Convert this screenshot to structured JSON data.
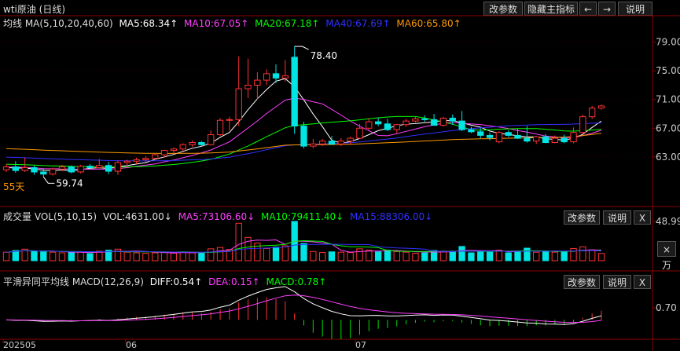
{
  "title": "wti原油 (日线)",
  "toolbar": {
    "edit_params": "改参数",
    "hide_indicator": "隐藏主指标",
    "left_arrow": "←",
    "right_arrow": "→",
    "help": "说明"
  },
  "ma_legend": {
    "label": "均线 MA(5,10,20,40,60)",
    "ma5": "MA5:68.34↑",
    "ma10": "MA10:67.05↑",
    "ma20": "MA20:67.18↑",
    "ma40": "MA40:67.69↑",
    "ma60": "MA60:65.80↑"
  },
  "vol_legend": {
    "label": "成交量 VOL(5,10,15)",
    "vol": "VOL:4631.00↓",
    "ma5": "MA5:73106.60↓",
    "ma10": "MA10:79411.40↓",
    "ma15": "MA15:88306.00↓"
  },
  "macd_legend": {
    "label": "平滑异同平均线 MACD(12,26,9)",
    "diff": "DIFF:0.54↑",
    "dea": "DEA:0.15↑",
    "macd": "MACD:0.78↑"
  },
  "panel_buttons": {
    "edit_params": "改参数",
    "help": "说明",
    "close": "X"
  },
  "vol_unit_button": "×万",
  "annotations": {
    "high": "78.40",
    "low": "59.74",
    "days": "55天"
  },
  "x_labels": [
    "202505",
    "06",
    "07"
  ],
  "colors": {
    "up": "#ff3232",
    "down": "#00e4e4",
    "ma5": "#ffffff",
    "ma10": "#ff40ff",
    "ma20": "#00ff00",
    "ma40": "#3030ff",
    "ma60": "#ff9900"
  },
  "chart_data": [
    {
      "type": "candlestick",
      "title": "wti原油 (日线)",
      "ylim": [
        57.5,
        80.5
      ],
      "yticks": [
        "79.00",
        "75.00",
        "71.00",
        "67.00",
        "63.00"
      ],
      "candles": [
        [
          61.2,
          62.0,
          60.9,
          61.6
        ],
        [
          61.6,
          62.4,
          60.8,
          61.1
        ],
        [
          61.1,
          62.9,
          60.9,
          61.5
        ],
        [
          61.5,
          61.8,
          60.5,
          60.9
        ],
        [
          60.9,
          61.4,
          60.2,
          60.6
        ],
        [
          60.6,
          61.5,
          60.4,
          61.3
        ],
        [
          61.3,
          61.9,
          61.0,
          61.6
        ],
        [
          61.6,
          61.8,
          60.7,
          60.9
        ],
        [
          60.9,
          61.9,
          60.7,
          61.7
        ],
        [
          61.7,
          62.0,
          61.3,
          61.5
        ],
        [
          61.5,
          62.7,
          61.3,
          61.8
        ],
        [
          61.8,
          62.3,
          60.6,
          61.0
        ],
        [
          61.0,
          62.5,
          60.5,
          62.2
        ],
        [
          62.2,
          62.6,
          61.5,
          62.4
        ],
        [
          62.4,
          62.9,
          62.0,
          62.6
        ],
        [
          62.6,
          63.1,
          62.3,
          62.8
        ],
        [
          62.8,
          63.4,
          62.5,
          63.3
        ],
        [
          63.3,
          64.0,
          62.9,
          63.9
        ],
        [
          63.9,
          64.3,
          63.5,
          64.1
        ],
        [
          64.1,
          64.9,
          63.8,
          64.7
        ],
        [
          64.7,
          65.3,
          64.4,
          65.0
        ],
        [
          65.0,
          65.2,
          64.4,
          64.7
        ],
        [
          64.7,
          66.7,
          64.6,
          66.1
        ],
        [
          66.1,
          68.4,
          65.9,
          68.1
        ],
        [
          68.1,
          68.6,
          66.7,
          68.2
        ],
        [
          68.2,
          77.0,
          67.3,
          72.5
        ],
        [
          72.5,
          76.7,
          71.2,
          73.0
        ],
        [
          73.0,
          74.8,
          71.0,
          73.7
        ],
        [
          73.7,
          75.2,
          73.0,
          74.6
        ],
        [
          74.6,
          75.9,
          73.3,
          74.0
        ],
        [
          74.0,
          76.5,
          73.5,
          74.3
        ],
        [
          76.9,
          78.4,
          66.2,
          67.3
        ],
        [
          67.3,
          67.9,
          64.2,
          64.5
        ],
        [
          64.5,
          65.5,
          64.2,
          64.8
        ],
        [
          64.8,
          65.5,
          64.5,
          65.2
        ],
        [
          65.2,
          65.9,
          64.7,
          64.8
        ],
        [
          64.8,
          65.6,
          64.5,
          65.2
        ],
        [
          65.2,
          65.8,
          64.8,
          65.6
        ],
        [
          65.6,
          67.6,
          65.5,
          67.0
        ],
        [
          67.0,
          68.4,
          66.7,
          67.9
        ],
        [
          67.9,
          68.5,
          67.3,
          67.6
        ],
        [
          67.6,
          68.3,
          66.6,
          66.8
        ],
        [
          66.8,
          67.6,
          66.3,
          67.5
        ],
        [
          67.5,
          68.3,
          67.2,
          68.0
        ],
        [
          68.0,
          68.6,
          67.8,
          68.3
        ],
        [
          68.3,
          68.8,
          67.9,
          68.2
        ],
        [
          68.2,
          69.0,
          67.4,
          67.4
        ],
        [
          67.4,
          68.6,
          67.2,
          68.4
        ],
        [
          68.4,
          68.9,
          67.5,
          68.0
        ],
        [
          68.0,
          69.4,
          66.6,
          66.8
        ],
        [
          66.8,
          67.2,
          66.3,
          66.5
        ],
        [
          66.5,
          67.0,
          65.6,
          66.0
        ],
        [
          66.0,
          66.4,
          65.3,
          65.7
        ],
        [
          65.1,
          66.6,
          64.9,
          66.4
        ],
        [
          66.4,
          66.7,
          65.8,
          66.0
        ],
        [
          66.0,
          66.9,
          65.5,
          65.6
        ],
        [
          65.6,
          67.3,
          65.0,
          65.2
        ],
        [
          65.2,
          65.9,
          64.8,
          65.8
        ],
        [
          65.8,
          66.2,
          64.9,
          65.0
        ],
        [
          65.0,
          66.0,
          64.9,
          65.6
        ],
        [
          65.6,
          66.1,
          64.9,
          65.1
        ],
        [
          65.1,
          67.1,
          64.9,
          66.4
        ],
        [
          66.4,
          68.9,
          66.2,
          68.6
        ],
        [
          68.6,
          70.1,
          68.3,
          69.8
        ],
        [
          69.8,
          70.3,
          69.6,
          70.1
        ]
      ]
    },
    {
      "type": "bar",
      "title": "成交量 VOL(5,10,15)",
      "ymax": 48.99,
      "ytick": "48.99"
    },
    {
      "type": "bar",
      "title": "平滑异同平均线 MACD(12,26,9)",
      "ytick": "0.70"
    }
  ]
}
